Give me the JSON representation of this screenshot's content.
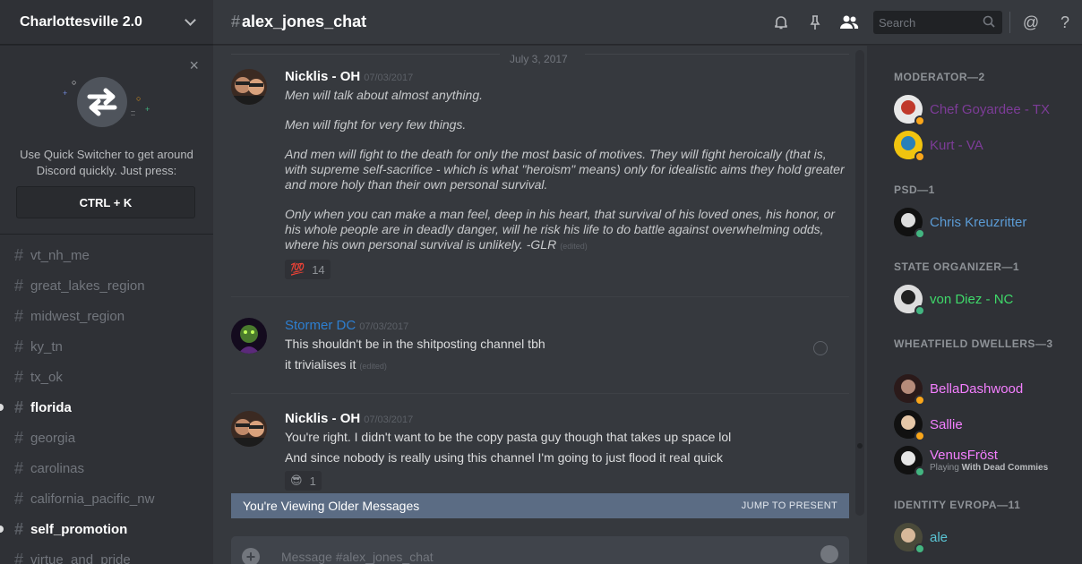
{
  "server": {
    "name": "Charlottesville 2.0"
  },
  "quick_switcher": {
    "close": "×",
    "text": "Use Quick Switcher to get around Discord quickly. Just press:",
    "shortcut": "CTRL + K"
  },
  "channels": [
    {
      "name": "vt_nh_me",
      "unread": false
    },
    {
      "name": "great_lakes_region",
      "unread": false
    },
    {
      "name": "midwest_region",
      "unread": false
    },
    {
      "name": "ky_tn",
      "unread": false
    },
    {
      "name": "tx_ok",
      "unread": false
    },
    {
      "name": "florida",
      "unread": true
    },
    {
      "name": "georgia",
      "unread": false
    },
    {
      "name": "carolinas",
      "unread": false
    },
    {
      "name": "california_pacific_nw",
      "unread": false
    },
    {
      "name": "self_promotion",
      "unread": true
    },
    {
      "name": "virtue_and_pride",
      "unread": false
    }
  ],
  "header": {
    "hash": "#",
    "channel": "alex_jones_chat",
    "search_placeholder": "Search",
    "mention": "@",
    "help": "?"
  },
  "date_divider": "July 3, 2017",
  "messages": [
    {
      "author": "Nicklis - OH",
      "timestamp": "07/03/2017",
      "lines": [
        "Men will talk about almost anything.",
        "Men will fight for very few things.",
        "And men will fight to the death for only the most basic of motives. They will fight heroically (that is, with supreme self-sacrifice - which is what \"heroism\" means) only for idealistic aims they hold greater and more holy than their own personal survival.",
        "Only when you can make a man feel, deep in his heart, that survival of his loved ones, his honor, or his whole people are in deadly danger, will he risk his life to do battle against overwhelming odds, where his own personal survival is unlikely.  -GLR"
      ],
      "edited": "(edited)",
      "reaction": {
        "emoji": "💯",
        "count": "14"
      }
    },
    {
      "author": "Stormer DC",
      "timestamp": "07/03/2017",
      "lines": [
        "This shouldn't be in the shitposting channel tbh",
        "it trivialises it"
      ],
      "edited": "(edited)"
    },
    {
      "author": "Nicklis - OH",
      "timestamp": "07/03/2017",
      "lines": [
        "You're right. I didn't want to be the copy pasta guy though that takes up space lol",
        "And since nobody is really using this channel I'm going to just flood it real quick"
      ],
      "reaction": {
        "emoji": "😎",
        "count": "1"
      }
    }
  ],
  "older_bar": {
    "text": "You're Viewing Older Messages",
    "jump": "JUMP TO PRESENT"
  },
  "composer": {
    "placeholder": "Message #alex_jones_chat",
    "plus": "+"
  },
  "member_groups": [
    {
      "role": "MODERATOR—2",
      "members": [
        {
          "name": "Chef Goyardee - TX",
          "color": "#7d3c98",
          "status": "#faa61a"
        },
        {
          "name": "Kurt - VA",
          "color": "#7d3c98",
          "status": "#faa61a"
        }
      ]
    },
    {
      "role": "PSD—1",
      "members": [
        {
          "name": "Chris Kreuzritter",
          "color": "#5b9bd5",
          "status": "#43b581"
        }
      ]
    },
    {
      "role": "STATE ORGANIZER—1",
      "members": [
        {
          "name": "von Diez - NC",
          "color": "#3fd96a",
          "status": "#43b581"
        }
      ]
    },
    {
      "role": "WHEATFIELD DWELLERS—3",
      "members": [
        {
          "name": "BellaDashwood",
          "color": "#f47fff",
          "status": "#faa61a"
        },
        {
          "name": "Sallie",
          "color": "#f47fff",
          "status": "#faa61a"
        },
        {
          "name": "VenusFröst",
          "color": "#f47fff",
          "status": "#43b581",
          "sub_prefix": "Playing ",
          "sub_game": "With Dead Commies"
        }
      ]
    },
    {
      "role": "IDENTITY EVROPA—11",
      "members": [
        {
          "name": "ale",
          "color": "#5bc6d6",
          "status": "#43b581"
        }
      ]
    }
  ]
}
